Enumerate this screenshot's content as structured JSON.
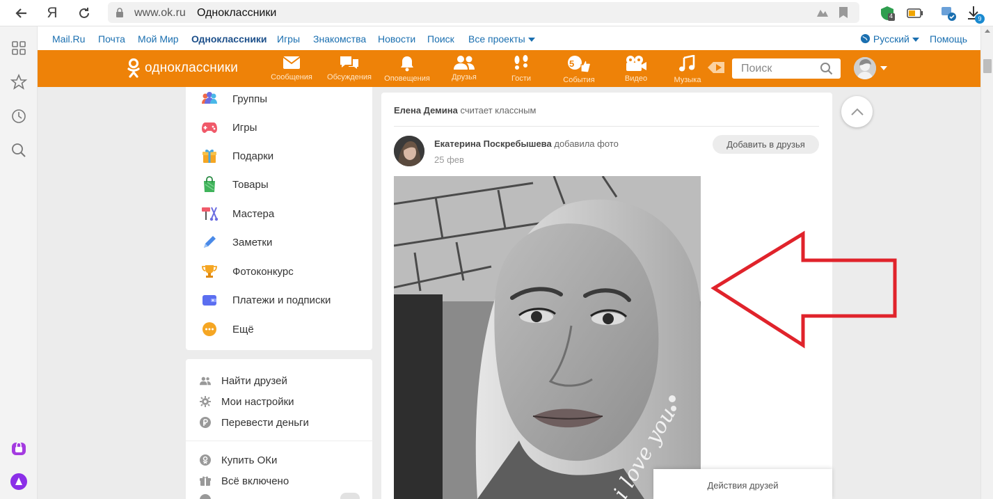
{
  "browser": {
    "domain": "www.ok.ru",
    "page_title": "Одноклассники",
    "yandex_letter": "Я",
    "download_badge": "9",
    "ext_badge": "4"
  },
  "projects": {
    "items": [
      {
        "label": "Mail.Ru"
      },
      {
        "label": "Почта"
      },
      {
        "label": "Мой Мир"
      },
      {
        "label": "Одноклассники"
      },
      {
        "label": "Игры"
      },
      {
        "label": "Знакомства"
      },
      {
        "label": "Новости"
      },
      {
        "label": "Поиск"
      },
      {
        "label": "Все проекты"
      }
    ],
    "language": "Русский",
    "help": "Помощь"
  },
  "toolbar": {
    "logo_text": "одноклассники",
    "nav": [
      {
        "label": "Сообщения",
        "icon": "envelope-icon"
      },
      {
        "label": "Обсуждения",
        "icon": "chat-bubbles-icon"
      },
      {
        "label": "Оповещения",
        "icon": "bell-icon"
      },
      {
        "label": "Друзья",
        "icon": "friends-icon"
      },
      {
        "label": "Гости",
        "icon": "footprints-icon"
      },
      {
        "label": "События",
        "icon": "events-like-icon",
        "badge": "5"
      },
      {
        "label": "Видео",
        "icon": "video-camera-icon"
      },
      {
        "label": "Музыка",
        "icon": "music-note-icon"
      }
    ],
    "search_placeholder": "Поиск"
  },
  "left_menu": {
    "items": [
      {
        "label": "Группы",
        "icon": "groups-icon"
      },
      {
        "label": "Игры",
        "icon": "gamepad-icon"
      },
      {
        "label": "Подарки",
        "icon": "gift-icon"
      },
      {
        "label": "Товары",
        "icon": "shopping-bag-icon"
      },
      {
        "label": "Мастера",
        "icon": "paint-tools-icon"
      },
      {
        "label": "Заметки",
        "icon": "pen-icon"
      },
      {
        "label": "Фотоконкурс",
        "icon": "trophy-icon"
      },
      {
        "label": "Платежи и подписки",
        "icon": "wallet-icon"
      },
      {
        "label": "Ещё",
        "icon": "more-dots-icon"
      }
    ],
    "secondary": [
      {
        "label": "Найти друзей",
        "icon": "find-friends-icon"
      },
      {
        "label": "Мои настройки",
        "icon": "gear-icon"
      },
      {
        "label": "Перевести деньги",
        "icon": "ruble-icon"
      }
    ],
    "tertiary": [
      {
        "label": "Купить ОКи",
        "icon": "ok-coin-icon"
      },
      {
        "label": "Всё включено",
        "icon": "all-inclusive-icon"
      }
    ]
  },
  "feed": {
    "activity_name": "Елена Демина",
    "activity_text": "считает классным",
    "post_author": "Екатерина Поскребышева",
    "post_action": "добавила фото",
    "post_date": "25 фев",
    "add_friend_label": "Добавить в друзья",
    "photo_caption": "i love you",
    "friends_actions": "Действия друзей"
  },
  "colors": {
    "ok_orange": "#ee8208",
    "link_blue": "#1a6fb0",
    "arrow_red": "#e0232b"
  }
}
